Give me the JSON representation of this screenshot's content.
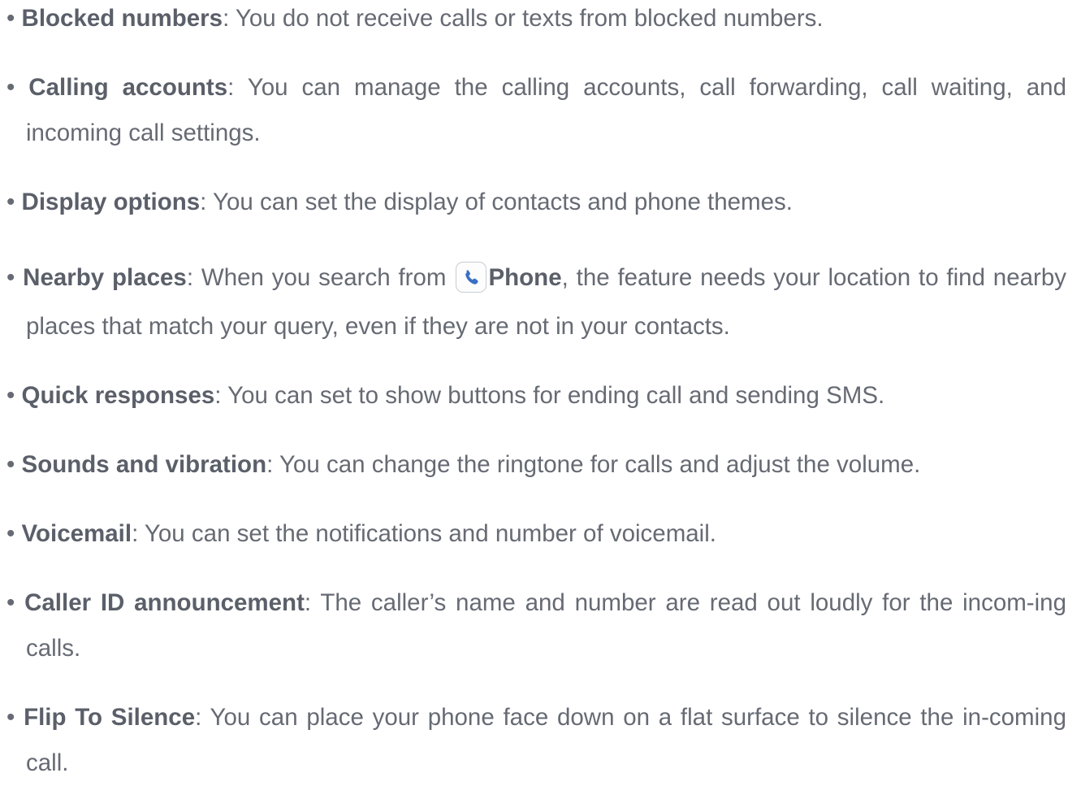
{
  "bullet": "•",
  "items": [
    {
      "term": "Blocked numbers",
      "desc": ": You do not receive calls or texts from blocked numbers."
    },
    {
      "term": "Calling accounts",
      "desc": ": You can manage the calling accounts, call forwarding, call waiting, and incoming call settings."
    },
    {
      "term": "Display options",
      "desc": ": You can set the display of contacts and phone themes."
    },
    {
      "term": "Nearby places",
      "desc_before": ": When you search from",
      "app_name": "Phone",
      "desc_after": ", the feature needs your location to find nearby places that match your query, even if they are not in your contacts.",
      "icon": "phone-app-icon"
    },
    {
      "term": "Quick responses",
      "desc": ": You can set to show buttons for ending call and sending SMS."
    },
    {
      "term": "Sounds and vibration",
      "desc": ": You can change the ringtone for calls and adjust the volume."
    },
    {
      "term": "Voicemail",
      "desc": ": You can set the notifications and number of voicemail."
    },
    {
      "term": "Caller ID announcement",
      "desc": ": The caller’s name and number are read out loudly for the incom-­ing calls."
    },
    {
      "term": "Flip To Silence",
      "desc": ": You can place your phone face down on a flat surface to silence the in-­coming call."
    }
  ],
  "colors": {
    "text": "#666a73",
    "term": "#5a5f69",
    "icon_blue": "#3a6fc4"
  }
}
